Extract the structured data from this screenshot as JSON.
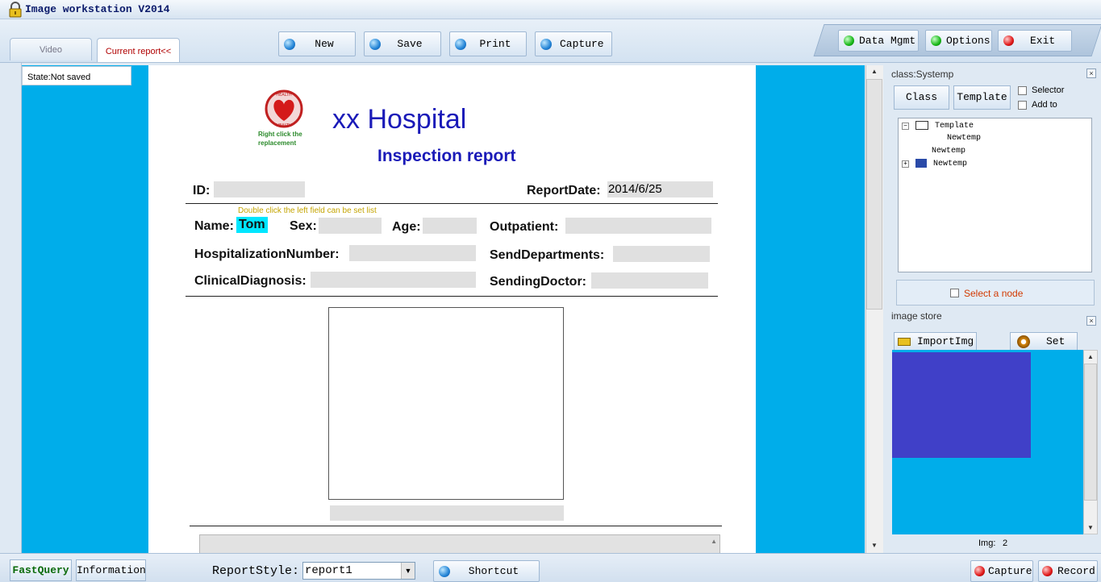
{
  "window": {
    "title": "Image workstation V2014"
  },
  "tabs": [
    {
      "label": "Video"
    },
    {
      "label": "Current report<<"
    }
  ],
  "toolbar": {
    "new": "New",
    "save": "Save",
    "print": "Print",
    "capture": "Capture"
  },
  "right_toolbar": {
    "data_mgmt": "Data Mgmt",
    "options": "Options",
    "exit": "Exit"
  },
  "state": "State:Not saved",
  "report": {
    "logo_caption": "Right click the replacement",
    "hospital_name": "xx Hospital",
    "title": "Inspection report",
    "id_label": "ID:",
    "id_value": "",
    "report_date_label": "ReportDate:",
    "report_date_value": "2014/6/25",
    "hint": "Double click the left field can be set list",
    "name_label": "Name:",
    "name_value": "Tom",
    "sex_label": "Sex:",
    "age_label": "Age:",
    "outpatient_label": "Outpatient:",
    "hosp_number_label": "HospitalizationNumber:",
    "send_dept_label": "SendDepartments:",
    "clinical_diag_label": "ClinicalDiagnosis:",
    "sending_doctor_label": "SendingDoctor:"
  },
  "class_panel": {
    "title": "class:Systemp",
    "class_button": "Class",
    "template_button": "Template",
    "selector_label": "Selector",
    "add_to_label": "Add to",
    "tree": [
      {
        "label": "Template",
        "icon": "book-icon"
      },
      {
        "label": "Newtemp",
        "icon": ""
      },
      {
        "label": "Newtemp",
        "icon": ""
      },
      {
        "label": "Newtemp",
        "icon": "books-icon"
      }
    ],
    "select_node_label": "Select a node"
  },
  "image_store": {
    "title": "image store",
    "import_button": "ImportImg",
    "set_button": "Set",
    "img_label": "Img:",
    "img_count": "2"
  },
  "bottombar": {
    "fast_query": "FastQuery",
    "information": "Information",
    "report_style_label": "ReportStyle:",
    "report_style_value": "report1",
    "shortcut": "Shortcut",
    "capture": "Capture",
    "record": "Record"
  },
  "colors": {
    "workspace": "#00adea",
    "hospital_blue": "#1a1ab8",
    "name_highlight": "#00e6ff",
    "thumbnail": "#4040c8"
  }
}
